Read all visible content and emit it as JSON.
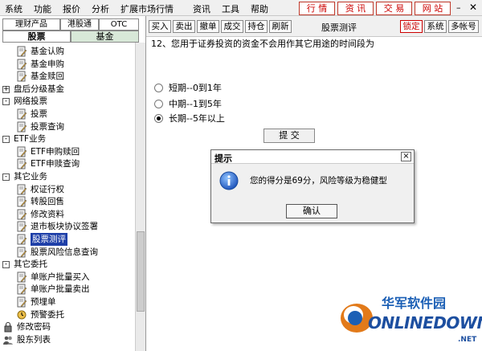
{
  "menubar": {
    "items": [
      "系统",
      "功能",
      "报价",
      "分析",
      "扩展市场行情",
      "资讯",
      "工具",
      "帮助"
    ],
    "quick_buttons": [
      "行 情",
      "资 讯",
      "交 易",
      "网 站"
    ]
  },
  "left": {
    "top_tabs": [
      "理财产品",
      "港股通",
      "OTC"
    ],
    "sub_tabs": [
      "股票",
      "基金"
    ],
    "tree": [
      {
        "label": "基金认购",
        "icon": "document-pen-icon"
      },
      {
        "label": "基金申购",
        "icon": "document-pen-icon"
      },
      {
        "label": "基金赎回",
        "icon": "document-pen-icon"
      },
      {
        "label": "盘后分级基金",
        "icon": "folder-icon",
        "expander": "+"
      },
      {
        "label": "网络投票",
        "icon": "folder-icon",
        "expander": "-"
      },
      {
        "label": "投票",
        "icon": "document-pen-icon"
      },
      {
        "label": "投票查询",
        "icon": "document-pen-icon"
      },
      {
        "label": "ETF业务",
        "icon": "folder-icon",
        "expander": "-"
      },
      {
        "label": "ETF申购赎回",
        "icon": "document-pen-icon"
      },
      {
        "label": "ETF申赎查询",
        "icon": "document-pen-icon"
      },
      {
        "label": "其它业务",
        "icon": "folder-icon",
        "expander": "-"
      },
      {
        "label": "权证行权",
        "icon": "document-pen-icon"
      },
      {
        "label": "转股回售",
        "icon": "document-pen-icon"
      },
      {
        "label": "修改资料",
        "icon": "document-pen-icon"
      },
      {
        "label": "退市板块协议签署",
        "icon": "document-pen-icon"
      },
      {
        "label": "股票测评",
        "icon": "document-pen-icon",
        "selected": true
      },
      {
        "label": "股票风险信息查询",
        "icon": "document-pen-icon"
      },
      {
        "label": "其它委托",
        "icon": "folder-icon",
        "expander": "-"
      },
      {
        "label": "单账户批量买入",
        "icon": "document-pen-icon"
      },
      {
        "label": "单账户批量卖出",
        "icon": "document-pen-icon"
      },
      {
        "label": "预埋单",
        "icon": "document-pen-icon"
      },
      {
        "label": "预警委托",
        "icon": "alarm-icon"
      },
      {
        "label": "修改密码",
        "icon": "lock-icon"
      },
      {
        "label": "股东列表",
        "icon": "people-icon"
      }
    ]
  },
  "toolbar": {
    "buttons": [
      "买入",
      "卖出",
      "撤单",
      "成交",
      "持仓",
      "刷新"
    ],
    "title": "股票测评",
    "right_buttons": [
      "锁定",
      "系统",
      "多帐号"
    ]
  },
  "form": {
    "question": "12、您用于证券投资的资金不会用作其它用途的时间段为",
    "options": [
      {
        "label": "短期--0到1年",
        "checked": false
      },
      {
        "label": "中期--1到5年",
        "checked": false
      },
      {
        "label": "长期--5年以上",
        "checked": true
      }
    ],
    "submit_label": "提 交"
  },
  "dialog": {
    "title": "提示",
    "close": "×",
    "message": "您的得分是69分，风险等级为稳健型",
    "ok_label": "确认"
  },
  "watermark": {
    "cn": "华军软件园",
    "en": "ONLINEDOWN",
    "suffix": ".NET"
  },
  "colors": {
    "selection": "#1e3fa8",
    "quick_button_red": "#c00000",
    "watermark_blue": "#1b5fb5"
  }
}
